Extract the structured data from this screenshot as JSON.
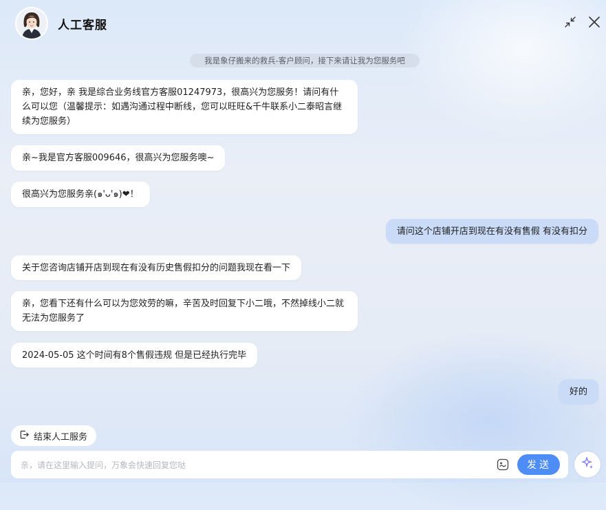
{
  "header": {
    "title": "人工客服",
    "avatar": "agent-avatar",
    "icons": [
      "minimize-icon",
      "close-icon"
    ]
  },
  "notice": "我是象仔搬来的救兵-客户顾问，接下来请让我为您服务吧",
  "messages": [
    {
      "role": "agent",
      "text": "亲，您好，亲 我是综合业务线官方客服01247973，很高兴为您服务！请问有什么可以您（温馨提示：如遇沟通过程中断线，您可以旺旺&千牛联系小二泰昭言继续为您服务）"
    },
    {
      "role": "agent",
      "text": "亲~我是官方客服009646，很高兴为您服务噢~"
    },
    {
      "role": "agent",
      "text": "很高兴为您服务亲(๑'ᴗ'๑)❤！"
    },
    {
      "role": "user",
      "text": "请问这个店铺开店到现在有没有售假 有没有扣分"
    },
    {
      "role": "agent",
      "text": "关于您咨询店铺开店到现在有没有历史售假扣分的问题我现在看一下"
    },
    {
      "role": "agent",
      "text": "亲，您看下还有什么可以为您效劳的嘛，辛苦及时回复下小二哦，不然掉线小二就无法为您服务了"
    },
    {
      "role": "agent",
      "text": "2024-05-05 这个时间有8个售假违规 但是已经执行完毕"
    },
    {
      "role": "user",
      "text": "好的"
    }
  ],
  "footer": {
    "end_service_label": "结束人工服务",
    "input_placeholder": "亲，请在这里输入提问，万象会快速回复您哒",
    "send_label": "发送",
    "icons": [
      "exit-icon",
      "emoji-icon",
      "sparkle-icon"
    ]
  },
  "colors": {
    "accent": "#4d8df5",
    "user_bubble": "#c9dbf7",
    "agent_bubble": "#ffffff"
  }
}
